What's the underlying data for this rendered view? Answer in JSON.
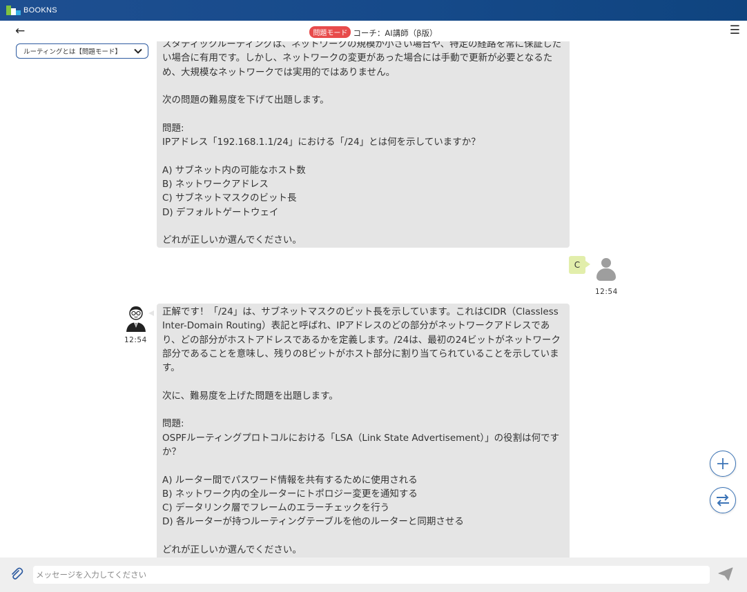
{
  "app": {
    "brand": "BOOKNS"
  },
  "header": {
    "mode_badge": "問題モード",
    "title": "コーチ：AI講師（β版）"
  },
  "dropdown": {
    "selected": "ルーティングとは【問題モード】"
  },
  "messages": {
    "coach_1": {
      "lines": [
        "スタティックルーティングは、ネットワークの規模が小さい場合や、特定の経路を常に保証した",
        "い場合に有用です。しかし、ネットワークの変更があった場合には手動で更新が必要となるた",
        "め、大規模なネットワークでは実用的ではありません。",
        "",
        "次の問題の難易度を下げて出題します。",
        "",
        "問題:",
        "IPアドレス「192.168.1.1/24」における「/24」とは何を示していますか？",
        "",
        "A) サブネット内の可能なホスト数",
        "B) ネットワークアドレス",
        "C) サブネットマスクのビット長",
        "D) デフォルトゲートウェイ",
        "",
        "どれが正しいか選んでください。"
      ]
    },
    "user_1": {
      "text": "C",
      "time": "12:54"
    },
    "coach_2": {
      "time": "12:54",
      "lines": [
        "正解です！「/24」は、サブネットマスクのビット長を示しています。これはCIDR（Classless",
        "Inter-Domain Routing）表記と呼ばれ、IPアドレスのどの部分がネットワークアドレスであ",
        "り、どの部分がホストアドレスであるかを定義します。/24は、最初の24ビットがネットワーク",
        "部分であることを意味し、残りの8ビットがホスト部分に割り当てられていることを示していま",
        "す。",
        "",
        "次に、難易度を上げた問題を出題します。",
        "",
        "問題:",
        "OSPFルーティングプロトコルにおける「LSA（Link State Advertisement）」の役割は何です",
        "か？",
        "",
        "A) ルーター間でパスワード情報を共有するために使用される",
        "B) ネットワーク内の全ルーターにトポロジー変更を通知する",
        "C) データリンク層でフレームのエラーチェックを行う",
        "D) 各ルーターが持つルーティングテーブルを他のルーターと同期させる",
        "",
        "どれが正しいか選んでください。"
      ]
    }
  },
  "composer": {
    "placeholder": "メッセージを入力してください"
  },
  "icons": {
    "back": "arrow-left-icon",
    "menu": "hamburger-icon",
    "attach": "paperclip-icon",
    "send": "send-icon",
    "add": "plus-icon",
    "switch": "swap-icon"
  },
  "colors": {
    "topbar": "#164a8a",
    "badge": "#e84b4b",
    "bubble": "#e5e5e5",
    "user_bubble": "#e2eeab",
    "accent": "#3a73b6"
  }
}
